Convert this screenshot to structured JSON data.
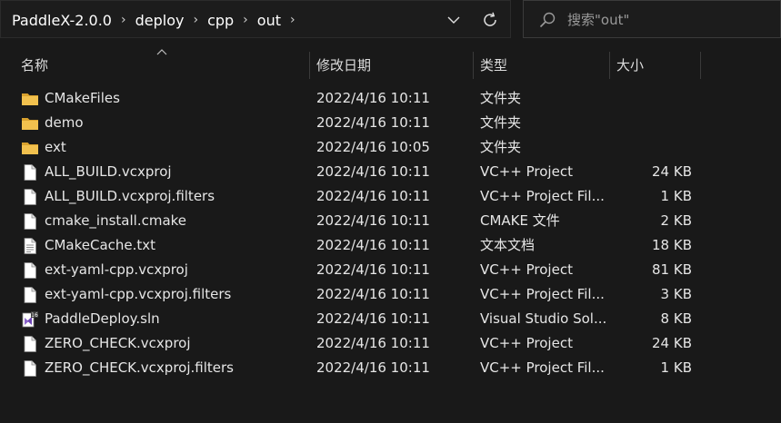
{
  "address": {
    "crumbs": [
      "PaddleX-2.0.0",
      "deploy",
      "cpp",
      "out"
    ],
    "separator": "›"
  },
  "search": {
    "placeholder": "搜索\"out\""
  },
  "columns": {
    "name": "名称",
    "modified": "修改日期",
    "type": "类型",
    "size": "大小"
  },
  "files": [
    {
      "name": "CMakeFiles",
      "date": "2022/4/16 10:11",
      "type": "文件夹",
      "size": "",
      "icon": "folder-icon"
    },
    {
      "name": "demo",
      "date": "2022/4/16 10:11",
      "type": "文件夹",
      "size": "",
      "icon": "folder-icon"
    },
    {
      "name": "ext",
      "date": "2022/4/16 10:05",
      "type": "文件夹",
      "size": "",
      "icon": "folder-icon"
    },
    {
      "name": "ALL_BUILD.vcxproj",
      "date": "2022/4/16 10:11",
      "type": "VC++ Project",
      "size": "24 KB",
      "icon": "file-icon"
    },
    {
      "name": "ALL_BUILD.vcxproj.filters",
      "date": "2022/4/16 10:11",
      "type": "VC++ Project Fil...",
      "size": "1 KB",
      "icon": "file-icon"
    },
    {
      "name": "cmake_install.cmake",
      "date": "2022/4/16 10:11",
      "type": "CMAKE 文件",
      "size": "2 KB",
      "icon": "file-icon"
    },
    {
      "name": "CMakeCache.txt",
      "date": "2022/4/16 10:11",
      "type": "文本文档",
      "size": "18 KB",
      "icon": "text-file-icon"
    },
    {
      "name": "ext-yaml-cpp.vcxproj",
      "date": "2022/4/16 10:11",
      "type": "VC++ Project",
      "size": "81 KB",
      "icon": "file-icon"
    },
    {
      "name": "ext-yaml-cpp.vcxproj.filters",
      "date": "2022/4/16 10:11",
      "type": "VC++ Project Fil...",
      "size": "3 KB",
      "icon": "file-icon"
    },
    {
      "name": "PaddleDeploy.sln",
      "date": "2022/4/16 10:11",
      "type": "Visual Studio Sol...",
      "size": "8 KB",
      "icon": "visual-studio-solution-icon"
    },
    {
      "name": "ZERO_CHECK.vcxproj",
      "date": "2022/4/16 10:11",
      "type": "VC++ Project",
      "size": "24 KB",
      "icon": "file-icon"
    },
    {
      "name": "ZERO_CHECK.vcxproj.filters",
      "date": "2022/4/16 10:11",
      "type": "VC++ Project Fil...",
      "size": "1 KB",
      "icon": "file-icon"
    }
  ],
  "colors": {
    "background": "#191919",
    "folder": "#f2c14e",
    "vs_purple": "#8a63c9"
  }
}
